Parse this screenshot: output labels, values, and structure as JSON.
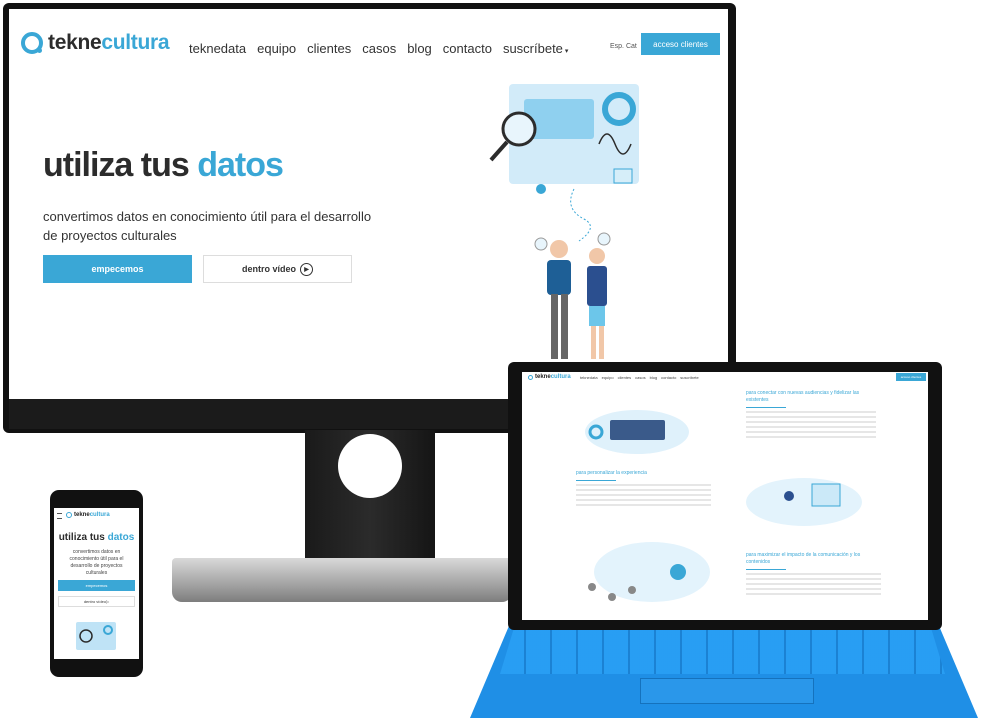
{
  "desktop": {
    "logo": {
      "part1": "tekne",
      "part2": "cultura"
    },
    "nav": [
      "teknedata",
      "equipo",
      "clientes",
      "casos",
      "blog",
      "contacto",
      "suscríbete"
    ],
    "lang": "Esp. Cat",
    "access_button": "acceso clientes",
    "hero": {
      "title_plain": "utiliza tus",
      "title_accent": "datos",
      "subtitle": "convertimos datos en conocimiento útil para el desarrollo de proyectos culturales",
      "primary_cta": "empecemos",
      "secondary_cta": "dentro vídeo"
    }
  },
  "phone": {
    "logo": {
      "part1": "tekne",
      "part2": "cultura"
    },
    "title_plain": "utiliza tus",
    "title_accent": "datos",
    "subtitle": "convertimos datos en conocimiento útil para el desarrollo de proyectos culturales",
    "primary_cta": "empecemos",
    "secondary_cta": "dentro vídeo"
  },
  "tablet": {
    "logo": {
      "part1": "tekne",
      "part2": "cultura"
    },
    "nav": [
      "teknedata",
      "equipo",
      "clientes",
      "casos",
      "blog",
      "contacto",
      "suscríbete"
    ],
    "access_button": "acceso clientes",
    "sections": [
      {
        "heading": "para conectar con nuevas audiencias y fidelizar las existentes"
      },
      {
        "heading": "para personalizar la experiencia"
      },
      {
        "heading": "para maximizar el impacto de la comunicación y los contenidos"
      }
    ]
  },
  "colors": {
    "accent": "#3aa7d6",
    "keyboard": "#1f8fe6"
  }
}
